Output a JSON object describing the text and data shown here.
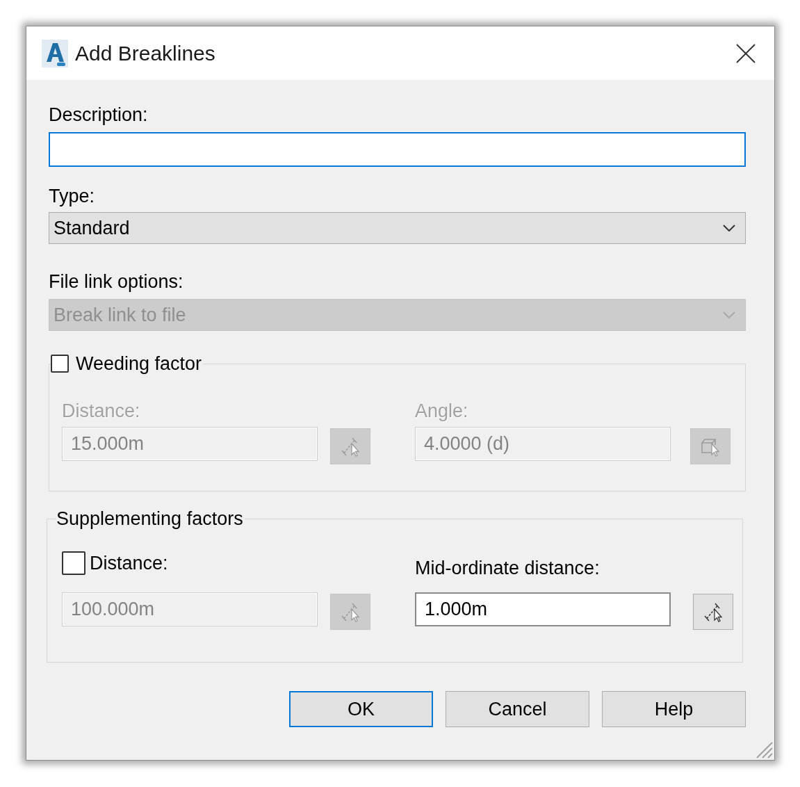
{
  "window": {
    "title": "Add Breaklines"
  },
  "description": {
    "label": "Description:",
    "focused": true
  },
  "type": {
    "label": "Type:",
    "value": "Standard",
    "disabled": false
  },
  "file_link": {
    "label": "File link options:",
    "value": "Break link to file",
    "disabled": true
  },
  "weeding": {
    "label": "Weeding factor",
    "checked": false,
    "fields": [
      {
        "label": "Distance:",
        "value": "15.000m",
        "disabled": true,
        "kind": "distance"
      },
      {
        "label": "Angle:",
        "value": "4.0000 (d)",
        "disabled": true,
        "kind": "angle"
      }
    ]
  },
  "supplementing": {
    "title": "Supplementing factors",
    "fields": [
      {
        "label": "Distance:",
        "checked": false,
        "value": "100.000m",
        "disabled": true,
        "kind": "distance"
      },
      {
        "label": "Mid-ordinate distance:",
        "value": "1.000m",
        "disabled": false,
        "kind": "distance"
      }
    ]
  },
  "buttons": [
    {
      "label": "OK",
      "default": true
    },
    {
      "label": "Cancel",
      "default": false
    },
    {
      "label": "Help",
      "default": false
    }
  ]
}
